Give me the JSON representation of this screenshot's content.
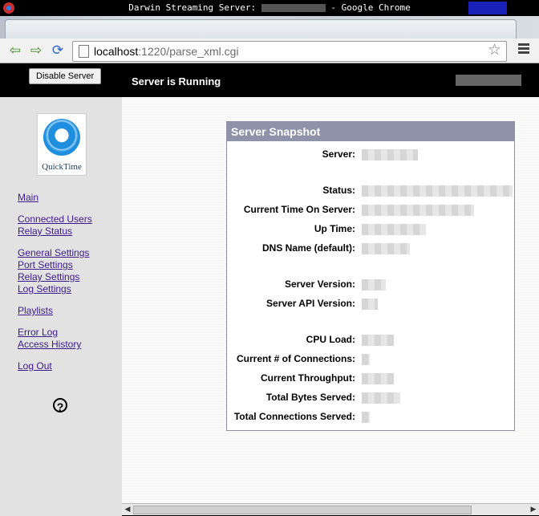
{
  "window": {
    "title_prefix": "Darwin Streaming Server: ",
    "title_suffix": " - Google Chrome"
  },
  "toolbar": {
    "url_host": "localhost",
    "url_rest": ":1220/parse_xml.cgi"
  },
  "header": {
    "disable_button": "Disable Server",
    "status_text": "Server is Running"
  },
  "sidebar": {
    "logo_text": "QuickTime",
    "links": [
      {
        "label": "Main"
      },
      {
        "label": "Connected Users"
      },
      {
        "label": "Relay Status"
      },
      {
        "label": "General Settings"
      },
      {
        "label": "Port Settings"
      },
      {
        "label": "Relay Settings"
      },
      {
        "label": "Log Settings"
      },
      {
        "label": "Playlists"
      },
      {
        "label": "Error Log"
      },
      {
        "label": "Access History"
      },
      {
        "label": "Log Out"
      }
    ],
    "help_glyph": "?"
  },
  "snapshot": {
    "title": "Server Snapshot",
    "rows": [
      {
        "label": "Server:"
      },
      {
        "label": "Status:"
      },
      {
        "label": "Current Time On Server:"
      },
      {
        "label": "Up Time:"
      },
      {
        "label": "DNS Name (default):"
      },
      {
        "label": "Server Version:"
      },
      {
        "label": "Server API Version:"
      },
      {
        "label": "CPU Load:"
      },
      {
        "label": "Current # of Connections:"
      },
      {
        "label": "Current Throughput:"
      },
      {
        "label": "Total Bytes Served:"
      },
      {
        "label": "Total Connections Served:"
      }
    ]
  }
}
